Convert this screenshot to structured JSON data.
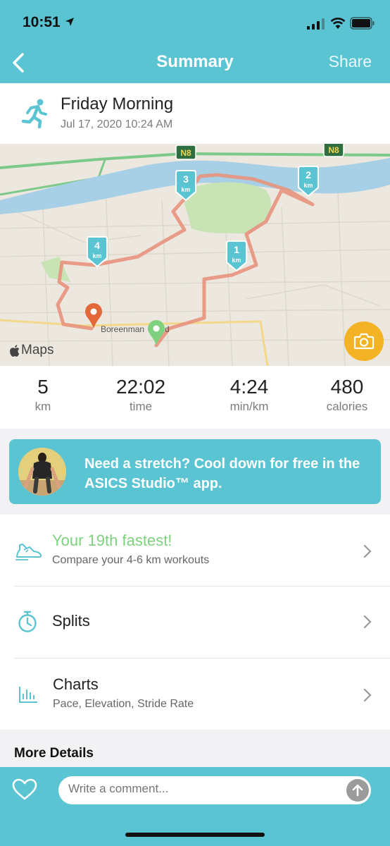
{
  "status_bar": {
    "time": "10:51"
  },
  "nav": {
    "title": "Summary",
    "share_label": "Share"
  },
  "workout": {
    "title": "Friday Morning",
    "date": "Jul 17, 2020 10:24 AM"
  },
  "map": {
    "road_label_1": "N8",
    "road_label_2": "N8",
    "street_label": "Boreenmanna Road",
    "street_label_visible": "Boreenman",
    "street_label_tail": "d",
    "km_markers": [
      {
        "num": "1",
        "unit": "km"
      },
      {
        "num": "2",
        "unit": "km"
      },
      {
        "num": "3",
        "unit": "km"
      },
      {
        "num": "4",
        "unit": "km"
      }
    ],
    "attribution": "Maps"
  },
  "stats": [
    {
      "value": "5",
      "label": "km"
    },
    {
      "value": "22:02",
      "label": "time"
    },
    {
      "value": "4:24",
      "label": "min/km"
    },
    {
      "value": "480",
      "label": "calories"
    }
  ],
  "promo": {
    "text": "Need a stretch? Cool down for free in the ASICS Studio™ app."
  },
  "list": {
    "fastest": {
      "title": "Your 19th fastest!",
      "subtitle": "Compare your 4-6 km workouts"
    },
    "splits": {
      "title": "Splits"
    },
    "charts": {
      "title": "Charts",
      "subtitle": "Pace, Elevation, Stride Rate"
    }
  },
  "more_details": "More Details",
  "comment": {
    "placeholder": "Write a comment..."
  },
  "colors": {
    "accent": "#5bc4d3",
    "route": "#e8927d",
    "fastest": "#7fd07f",
    "camera": "#f4b324"
  }
}
